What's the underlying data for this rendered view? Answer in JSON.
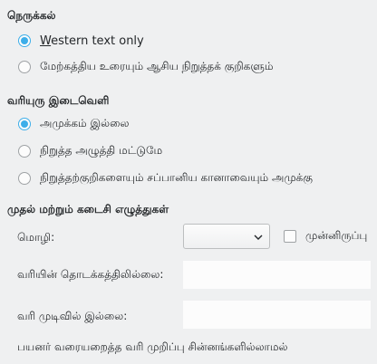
{
  "wrapping": {
    "title": "நெருக்கல்",
    "options": [
      {
        "label_underlined": "W",
        "label_rest": "estern text only",
        "checked": true
      },
      {
        "label": "மேற்கத்திய உரையும் ஆசிய நிறுத்தக் குறிகளும்",
        "checked": false
      }
    ]
  },
  "spacing": {
    "title": "வரியுரு இடைவெளி",
    "options": [
      {
        "label": "அமுக்கம் இல்லை",
        "checked": true
      },
      {
        "label": "நிறுத்த அழுத்தி மட்டுமே",
        "checked": false
      },
      {
        "label": "நிறுத்தற்குறிகளையும் சப்பானிய கானாவையும் அமுக்கு",
        "checked": false
      }
    ]
  },
  "first_last": {
    "title": "முதல் மற்றும் கடைசி எழுத்துகள்",
    "language_label": "மொழி:",
    "language_value": "",
    "default_checkbox_label": "முன்னிருப்பு",
    "default_checked": false,
    "not_at_start_label": "வரியின் தொடக்கத்திலில்லை:",
    "not_at_start_value": "",
    "not_at_end_label": "வரி முடிவில் இல்லை:",
    "not_at_end_value": "",
    "footer": "பயனர் வரையறைத்த வரி முறிப்பு சின்னங்களில்லாமல்"
  },
  "colors": {
    "accent": "#3daee9",
    "window_bg": "#eff0f1",
    "field_bg": "#fcfcfc"
  }
}
